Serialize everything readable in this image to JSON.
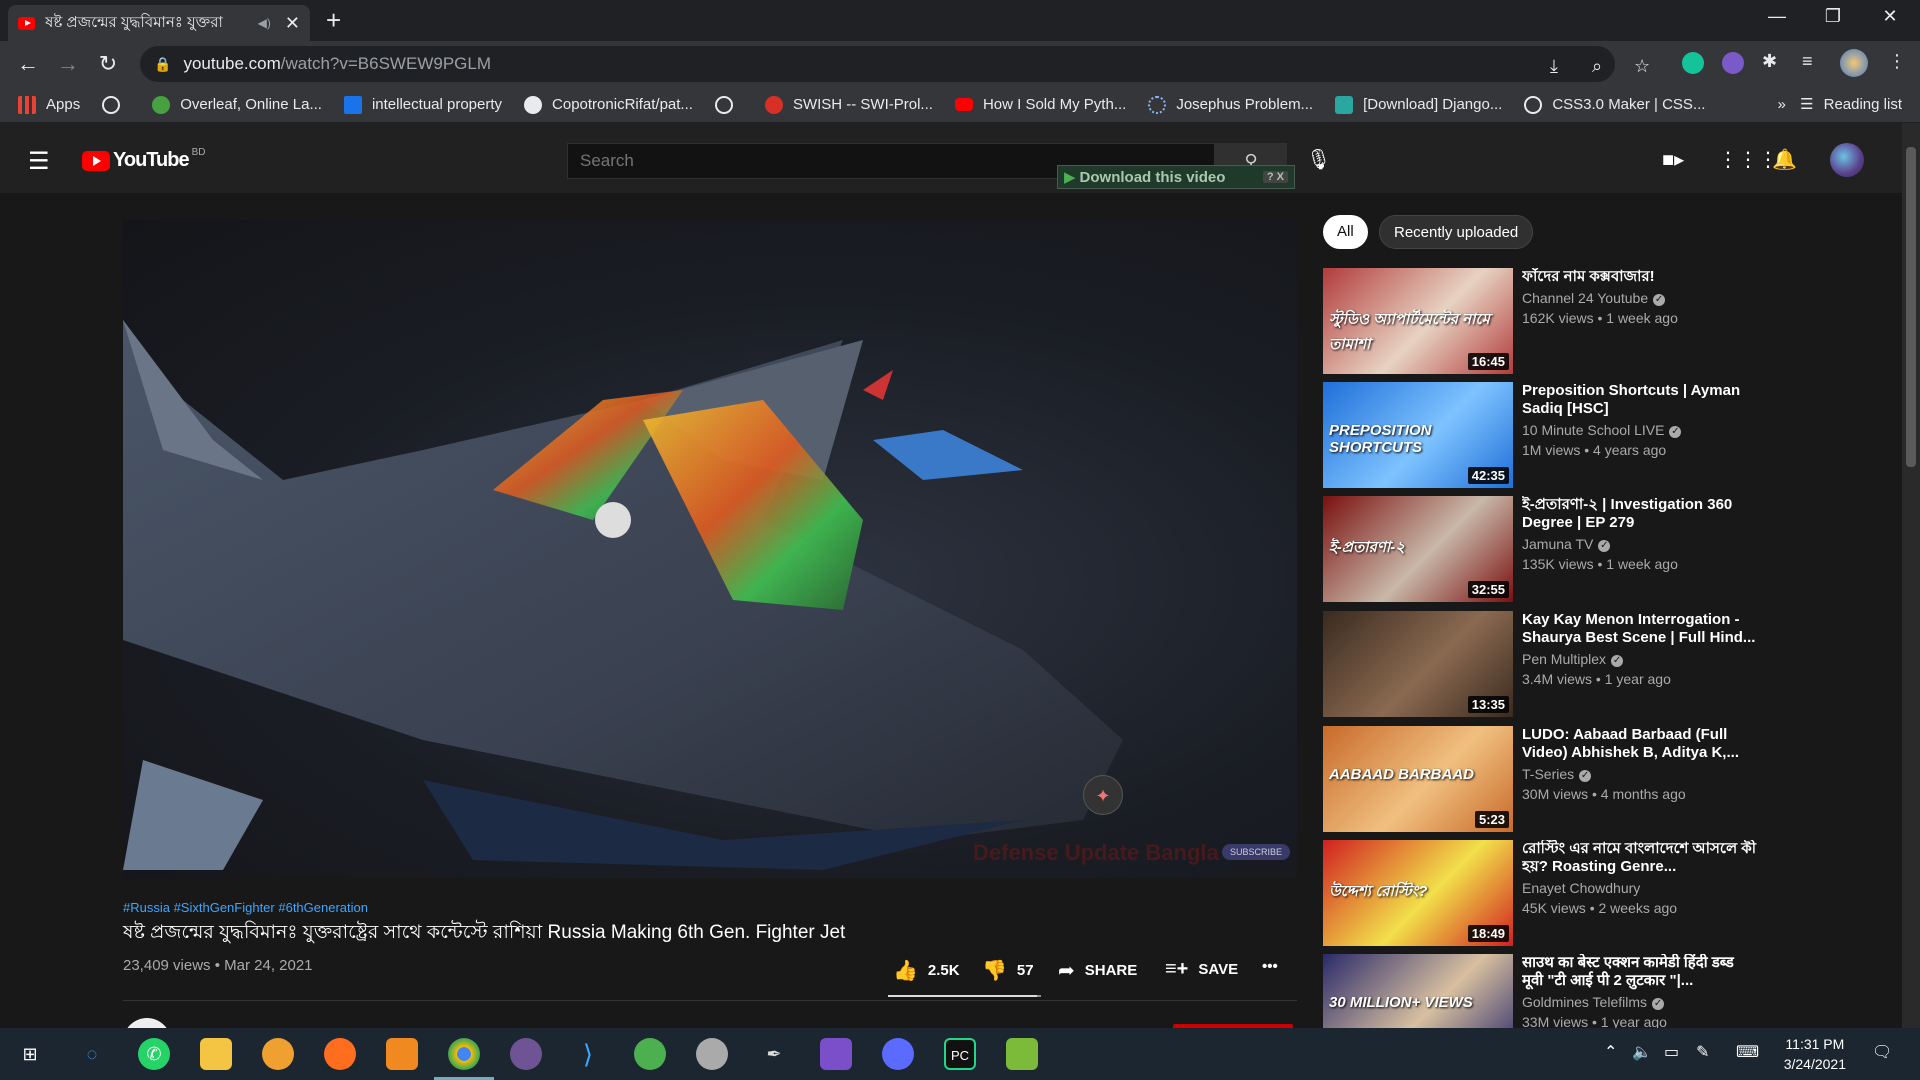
{
  "browser": {
    "tab_title": "ষষ্ট প্রজন্মের যুদ্ধবিমানঃ যুক্তরা",
    "url_host": "youtube.com",
    "url_path": "/watch?v=B6SWEW9PGLM",
    "new_tab": "+",
    "close_tab": "✕",
    "bookmarks": [
      {
        "label": "Apps",
        "color": "#ea4335"
      },
      {
        "label": "",
        "color": "#9aa0a6"
      },
      {
        "label": "Overleaf, Online La...",
        "color": "#47a141"
      },
      {
        "label": "intellectual property",
        "color": "#1a73e8"
      },
      {
        "label": "CopotronicRifat/pat...",
        "color": "#e8eaed"
      },
      {
        "label": "",
        "color": "#9aa0a6"
      },
      {
        "label": "SWISH -- SWI-Prol...",
        "color": "#d93025"
      },
      {
        "label": "How I Sold My Pyth...",
        "color": "#ff0000"
      },
      {
        "label": "Josephus Problem...",
        "color": "#5f6368"
      },
      {
        "label": "[Download] Django...",
        "color": "#2aa7a0"
      },
      {
        "label": "CSS3.0 Maker | CSS...",
        "color": "#9aa0a6"
      }
    ],
    "more_bookmarks": "»",
    "reading_list": "Reading list"
  },
  "youtube": {
    "logo_word": "YouTube",
    "country": "BD",
    "search_placeholder": "Search",
    "download_bar": "Download this video",
    "download_q": "? X"
  },
  "video": {
    "hashtags": "#Russia #SixthGenFighter #6thGeneration",
    "title": "ষষ্ট প্রজন্মের যুদ্ধবিমানঃ যুক্তরাষ্ট্রের সাথে কন্টেস্টে রাশিয়া Russia Making 6th Gen. Fighter Jet",
    "meta": "23,409 views • Mar 24, 2021",
    "likes": "2.5K",
    "dislikes": "57",
    "share": "SHARE",
    "save": "SAVE",
    "more": "•••",
    "watermark": "Defense Update Bangla",
    "subscribe_wm": "SUBSCRIBE",
    "like_ratio": 0.977
  },
  "sidebar": {
    "chips": [
      "All",
      "Recently uploaded"
    ],
    "items": [
      {
        "title": "ফাঁদের নাম কক্সবাজার!",
        "channel": "Channel 24 Youtube",
        "verified": true,
        "meta": "162K views • 1 week ago",
        "duration": "16:45",
        "caption": "স্টুডিও অ্যাপার্টমেন্টের নামে তামাশা",
        "c1": "#b23b3b",
        "c2": "#e7d3c2"
      },
      {
        "title": "Preposition Shortcuts | Ayman Sadiq [HSC]",
        "channel": "10 Minute School LIVE",
        "verified": true,
        "meta": "1M views • 4 years ago",
        "duration": "42:35",
        "caption": "PREPOSITION SHORTCUTS",
        "c1": "#1e6fd9",
        "c2": "#7ec3ff"
      },
      {
        "title": "ই-প্রতারণা-২ | Investigation 360 Degree | EP 279",
        "channel": "Jamuna TV",
        "verified": true,
        "meta": "135K views • 1 week ago",
        "duration": "32:55",
        "caption": "ই-প্রতারণা-২",
        "c1": "#7a1010",
        "c2": "#c8b8a8"
      },
      {
        "title": "Kay Kay Menon Interrogation - Shaurya Best Scene | Full Hind...",
        "channel": "Pen Multiplex",
        "verified": true,
        "meta": "3.4M views • 1 year ago",
        "duration": "13:35",
        "caption": "",
        "c1": "#3a2a20",
        "c2": "#8a6a50"
      },
      {
        "title": "LUDO: Aabaad Barbaad (Full Video) Abhishek B, Aditya K,...",
        "channel": "T-Series",
        "verified": true,
        "meta": "30M views • 4 months ago",
        "duration": "5:23",
        "caption": "AABAAD BARBAAD",
        "c1": "#c86a2a",
        "c2": "#f0c080"
      },
      {
        "title": "রোস্টিং এর নামে বাংলাদেশে আসলে কী হয়? Roasting Genre...",
        "channel": "Enayet Chowdhury",
        "verified": false,
        "meta": "45K views • 2 weeks ago",
        "duration": "18:49",
        "caption": "উদ্দেশ্য রোস্টিং?",
        "c1": "#d02020",
        "c2": "#f2e04a"
      },
      {
        "title": "साउथ का बेस्ट एक्शन कामेडी हिंदी डब्ड मूवी \"टी आई पी 2 लुटकार \"|...",
        "channel": "Goldmines Telefilms",
        "verified": true,
        "meta": "33M views • 1 year ago",
        "duration": "",
        "caption": "30 MILLION+ VIEWS",
        "c1": "#2a2a6a",
        "c2": "#d8c0a0"
      }
    ]
  },
  "taskbar": {
    "time": "11:31 PM",
    "date": "3/24/2021"
  }
}
